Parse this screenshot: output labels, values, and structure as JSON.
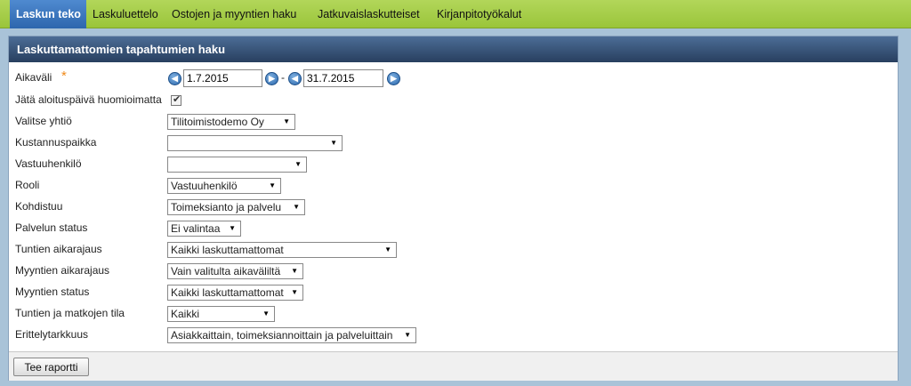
{
  "nav": {
    "tabs": [
      "Laskun teko",
      "Laskuluettelo",
      "Ostojen ja myyntien haku",
      "Jatkuvaislaskutteiset",
      "Kirjanpitotyökalut"
    ],
    "active_tab": "Laskun teko",
    "active_color": "#3a75bd",
    "bar_color": "#a6cd46"
  },
  "panel": {
    "title": "Laskuttamattomien tapahtumien haku",
    "header_color": "#34507a"
  },
  "form": {
    "period": {
      "label": "Aikaväli",
      "required_mark": "*",
      "start": "1.7.2015",
      "separator": "-",
      "end": "31.7.2015",
      "prev_icon": "arrow-left-circle-icon",
      "next_icon": "arrow-right-circle-icon"
    },
    "ignore_start": {
      "label": "Jätä aloituspäivä huomioimatta",
      "checked": true
    },
    "fields": [
      {
        "label": "Valitse yhtiö",
        "value": "Tilitoimistodemo Oy"
      },
      {
        "label": "Kustannuspaikka",
        "value": ""
      },
      {
        "label": "Vastuuhenkilö",
        "value": ""
      },
      {
        "label": "Rooli",
        "value": "Vastuuhenkilö"
      },
      {
        "label": "Kohdistuu",
        "value": "Toimeksianto ja palvelu"
      },
      {
        "label": "Palvelun status",
        "value": "Ei valintaa"
      },
      {
        "label": "Tuntien aikarajaus",
        "value": "Kaikki laskuttamattomat"
      },
      {
        "label": "Myyntien aikarajaus",
        "value": "Vain valitulta aikaväliltä"
      },
      {
        "label": "Myyntien status",
        "value": "Kaikki laskuttamattomat"
      },
      {
        "label": "Tuntien ja matkojen tila",
        "value": "Kaikki"
      },
      {
        "label": "Erittelytarkkuus",
        "value": "Asiakkaittain, toimeksiannoittain ja palveluittain"
      }
    ]
  },
  "footer": {
    "report_button": "Tee raportti"
  }
}
